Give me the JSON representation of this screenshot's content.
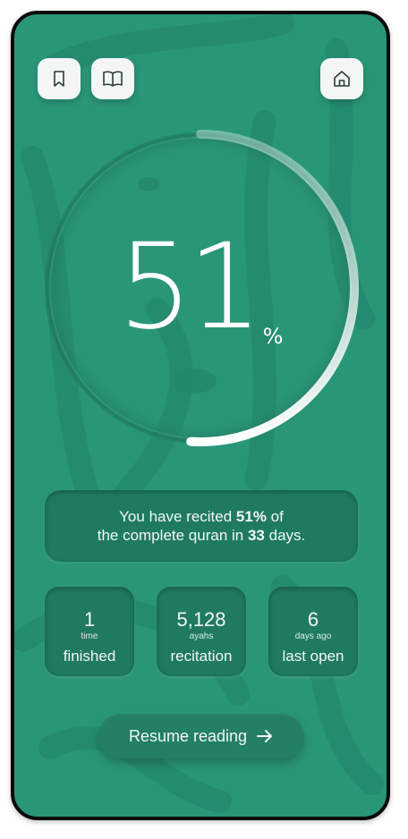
{
  "colors": {
    "background": "#2a9678",
    "card": "#1f7a60",
    "text": "#f2f7f5",
    "button_light": "#f3f6f5",
    "icon": "#2b3b36"
  },
  "toolbar": {
    "bookmark_icon": "bookmark-icon",
    "book_icon": "open-book-icon",
    "home_icon": "home-icon"
  },
  "progress": {
    "value": "51",
    "unit": "%",
    "fraction": 0.51
  },
  "summary": {
    "line1_prefix": "You have recited ",
    "line1_bold": "51%",
    "line1_suffix": " of",
    "line2_prefix": "the complete quran in ",
    "line2_bold": "33",
    "line2_suffix": " days."
  },
  "stats": [
    {
      "value": "1",
      "sub": "time",
      "label": "finished"
    },
    {
      "value": "5,128",
      "sub": "ayahs",
      "label": "recitation"
    },
    {
      "value": "6",
      "sub": "days ago",
      "label": "last open"
    }
  ],
  "resume": {
    "label": "Resume reading",
    "icon": "arrow-right-icon"
  }
}
